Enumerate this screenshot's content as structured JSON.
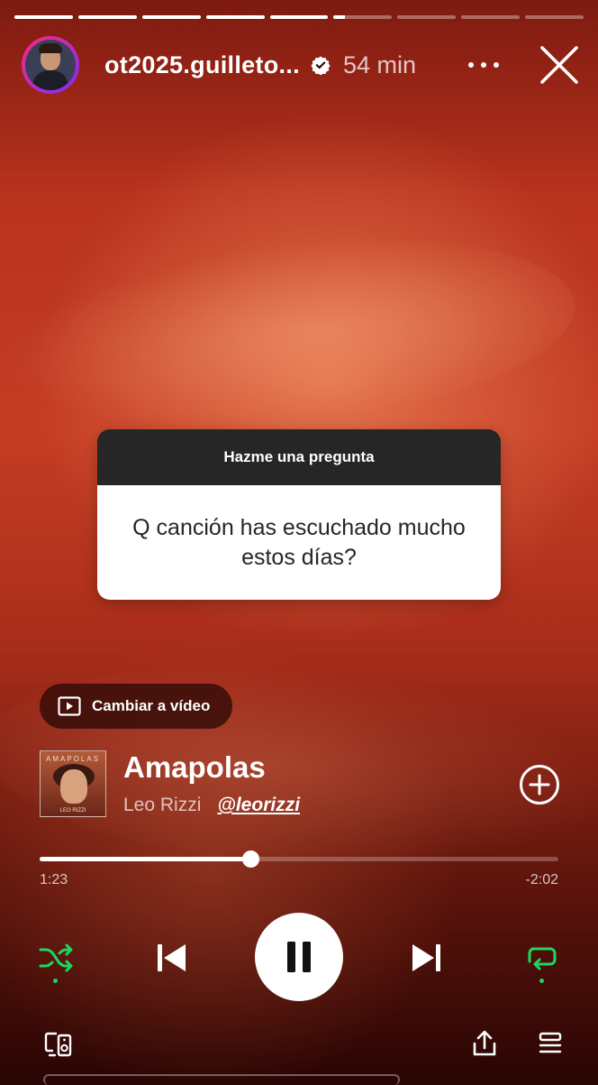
{
  "story": {
    "segments_total": 9,
    "segments_completed": 5,
    "current_segment_progress": 0.2
  },
  "header": {
    "username": "ot2025.guilleto...",
    "time_ago": "54 min"
  },
  "question_sticker": {
    "title": "Hazme una pregunta",
    "question": "Q canción has escuchado mucho estos días?"
  },
  "switch_button": {
    "label": "Cambiar a vídeo"
  },
  "cover": {
    "title": "AMAPOLAS",
    "artist": "LEO RIZZI"
  },
  "track": {
    "title": "Amapolas",
    "artist": "Leo Rizzi",
    "mention": "@leorizzi",
    "elapsed": "1:23",
    "remaining": "-2:02",
    "progress": 0.406
  },
  "icons": {
    "verified": "verified-badge-icon",
    "more": "more-options-icon",
    "close": "close-icon",
    "video": "play-video-icon",
    "add": "add-circle-icon",
    "shuffle": "shuffle-icon",
    "previous": "skip-previous-icon",
    "pause": "pause-icon",
    "next": "skip-next-icon",
    "repeat": "repeat-icon",
    "devices": "connect-device-icon",
    "share": "share-icon",
    "queue": "queue-icon"
  },
  "colors": {
    "accent_green": "#1ed760",
    "sticker_header": "#262626",
    "background_red": "#c53d24"
  }
}
